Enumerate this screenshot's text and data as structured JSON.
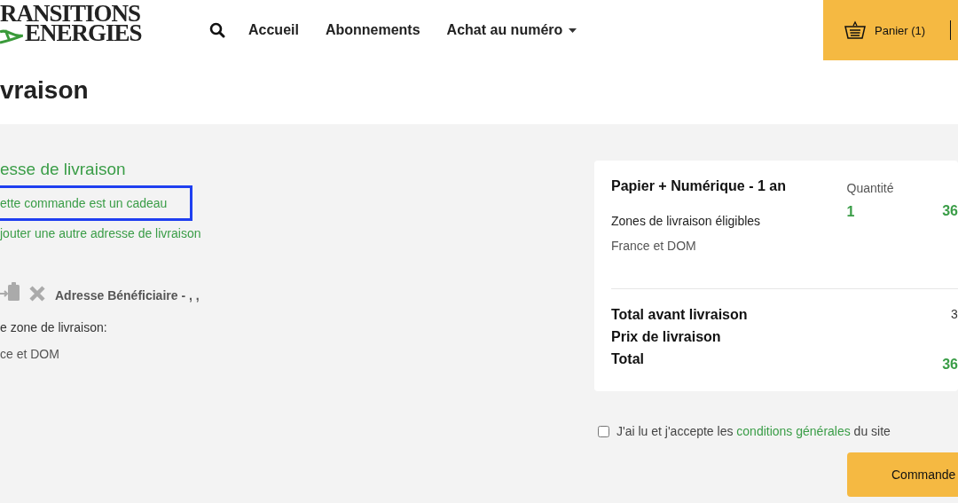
{
  "header": {
    "logo": {
      "line_1": "RANSITIONS",
      "line_2": "ENERGIES"
    },
    "nav": [
      {
        "label": "Accueil",
        "kind": "link"
      },
      {
        "label": "Abonnements",
        "kind": "link"
      },
      {
        "label": "Achat au numéro",
        "kind": "dropdown"
      }
    ],
    "cart": {
      "label": "Panier (1)"
    }
  },
  "page_title": "vraison",
  "delivery": {
    "heading": "esse de livraison",
    "gift_link": {
      "label": "ette commande est un cadeau",
      "focused": true
    },
    "add_address_link": "jouter une autre adresse de livraison",
    "address": {
      "title": "Adresse Bénéficiaire - , ,",
      "zone_label": "e zone de livraison:",
      "zone": "ce et DOM"
    }
  },
  "summary": {
    "product": "Papier + Numérique - 1 an",
    "quantity_label": "Quantité",
    "quantity": "1",
    "price": "36",
    "zones_label": "Zones de livraison éligibles",
    "zones": "France et DOM",
    "totals": [
      {
        "label": "Total avant livraison",
        "value": "3",
        "kind": "plain"
      },
      {
        "label": "Prix de livraison"
      },
      {
        "label": "Total",
        "value": "36",
        "kind": "highlight"
      }
    ]
  },
  "terms": {
    "checked": false,
    "before": "J'ai lu et j'accepte les",
    "link": "conditions générales",
    "after": "du site"
  },
  "order_button": "Commande"
}
